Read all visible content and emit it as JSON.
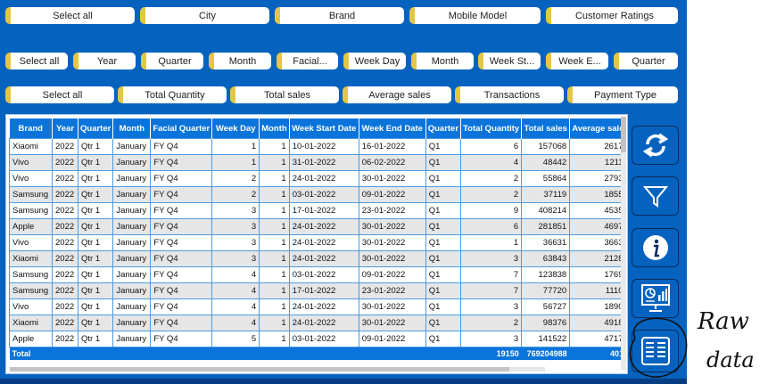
{
  "slicers": {
    "row1": [
      "Select all",
      "City",
      "Brand",
      "Mobile Model",
      "Customer Ratings"
    ],
    "row2": [
      "Select all",
      "Year",
      "Quarter",
      "Month",
      "Facial...",
      "Week Day",
      "Month",
      "Week St...",
      "Week E...",
      "Quarter"
    ],
    "row3": [
      "Select all",
      "Total Quantity",
      "Total sales",
      "Average sales",
      "Transactions",
      "Payment Type"
    ]
  },
  "table": {
    "columns": [
      "Brand",
      "Year",
      "Quarter",
      "Month",
      "Facial Quarter",
      "Week Day",
      "Month",
      "Week Start Date",
      "Week End Date",
      "Quarter",
      "Total Quantity",
      "Total sales",
      "Average sale"
    ],
    "rows": [
      [
        "Xiaomi",
        "2022",
        "Qtr 1",
        "January",
        "FY Q4",
        "1",
        "1",
        "10-01-2022",
        "16-01-2022",
        "Q1",
        "6",
        "157068",
        "2617"
      ],
      [
        "Vivo",
        "2022",
        "Qtr 1",
        "January",
        "FY Q4",
        "1",
        "1",
        "31-01-2022",
        "06-02-2022",
        "Q1",
        "4",
        "48442",
        "1211"
      ],
      [
        "Vivo",
        "2022",
        "Qtr 1",
        "January",
        "FY Q4",
        "2",
        "1",
        "24-01-2022",
        "30-01-2022",
        "Q1",
        "2",
        "55864",
        "2793"
      ],
      [
        "Samsung",
        "2022",
        "Qtr 1",
        "January",
        "FY Q4",
        "2",
        "1",
        "03-01-2022",
        "09-01-2022",
        "Q1",
        "2",
        "37119",
        "1855"
      ],
      [
        "Samsung",
        "2022",
        "Qtr 1",
        "January",
        "FY Q4",
        "3",
        "1",
        "17-01-2022",
        "23-01-2022",
        "Q1",
        "9",
        "408214",
        "4535"
      ],
      [
        "Apple",
        "2022",
        "Qtr 1",
        "January",
        "FY Q4",
        "3",
        "1",
        "24-01-2022",
        "30-01-2022",
        "Q1",
        "6",
        "281851",
        "4697"
      ],
      [
        "Vivo",
        "2022",
        "Qtr 1",
        "January",
        "FY Q4",
        "3",
        "1",
        "24-01-2022",
        "30-01-2022",
        "Q1",
        "1",
        "36631",
        "3663"
      ],
      [
        "Xiaomi",
        "2022",
        "Qtr 1",
        "January",
        "FY Q4",
        "3",
        "1",
        "24-01-2022",
        "30-01-2022",
        "Q1",
        "3",
        "63843",
        "2128"
      ],
      [
        "Samsung",
        "2022",
        "Qtr 1",
        "January",
        "FY Q4",
        "4",
        "1",
        "03-01-2022",
        "09-01-2022",
        "Q1",
        "7",
        "123838",
        "1769"
      ],
      [
        "Samsung",
        "2022",
        "Qtr 1",
        "January",
        "FY Q4",
        "4",
        "1",
        "17-01-2022",
        "23-01-2022",
        "Q1",
        "7",
        "77720",
        "1110"
      ],
      [
        "Vivo",
        "2022",
        "Qtr 1",
        "January",
        "FY Q4",
        "4",
        "1",
        "24-01-2022",
        "30-01-2022",
        "Q1",
        "3",
        "56727",
        "1890"
      ],
      [
        "Xiaomi",
        "2022",
        "Qtr 1",
        "January",
        "FY Q4",
        "4",
        "1",
        "24-01-2022",
        "30-01-2022",
        "Q1",
        "2",
        "98376",
        "4918"
      ],
      [
        "Apple",
        "2022",
        "Qtr 1",
        "January",
        "FY Q4",
        "5",
        "1",
        "03-01-2022",
        "09-01-2022",
        "Q1",
        "3",
        "141522",
        "4717"
      ]
    ],
    "total": {
      "label": "Total",
      "quantity": "19150",
      "sales": "769204988",
      "average": "401"
    }
  },
  "rail": {
    "buttons": [
      {
        "icon": "refresh-icon"
      },
      {
        "icon": "filter-icon"
      },
      {
        "icon": "info-icon"
      },
      {
        "icon": "dashboard-icon"
      },
      {
        "icon": "raw-data-icon"
      }
    ]
  },
  "annotation": {
    "line1": "Raw",
    "line2": "data"
  },
  "colors": {
    "panel": "#0563bf",
    "header": "#0a74da",
    "chip_accent": "#e3c646",
    "grid": "#4d9be0"
  }
}
